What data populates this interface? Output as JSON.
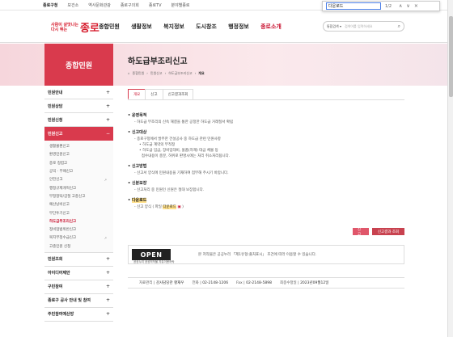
{
  "topbar": {
    "links": [
      "종로구청",
      "보건소",
      "역사문화관광",
      "종로구의회",
      "종로TV",
      "분야별종로"
    ]
  },
  "findbar": {
    "query": "다운로드",
    "count": "1/2",
    "up": "∧",
    "down": "∨",
    "close": "×"
  },
  "logo": {
    "line1": "사람이 살맛나는",
    "line2": "다시 뛰는",
    "name": "종로"
  },
  "gnb": [
    "종합민원",
    "생활정보",
    "복지정보",
    "도시창조",
    "행정정보",
    "종로소개"
  ],
  "gsearch": {
    "select": "통합검색 ▾",
    "placeholder": "검색어를 입력하세요"
  },
  "lnb": {
    "title": "종합민원",
    "items_top": [
      {
        "label": "민원안내",
        "pm": "+"
      },
      {
        "label": "민원상담",
        "pm": "+"
      },
      {
        "label": "민원신청",
        "pm": "+"
      }
    ],
    "active": {
      "label": "민원신고",
      "pm": "−"
    },
    "sub": [
      {
        "label": "생활불편신고",
        "ext": ""
      },
      {
        "label": "환경민원신고",
        "ext": ""
      },
      {
        "label": "종로 청렴고",
        "ext": ""
      },
      {
        "label": "공익 · 부패신고",
        "ext": ""
      },
      {
        "label": "안전신고",
        "ext": "↗"
      },
      {
        "label": "행정규제개혁신고",
        "ext": ""
      },
      {
        "label": "부정청탁/갑질 고충신고",
        "ext": ""
      },
      {
        "label": "예산낭비신고",
        "ext": ""
      },
      {
        "label": "무단투기신고",
        "ext": ""
      },
      {
        "label": "하도급부조리신고",
        "ext": ""
      },
      {
        "label": "정비업법위반신고",
        "ext": ""
      },
      {
        "label": "복지부정수급신고",
        "ext": "↗"
      },
      {
        "label": "고충민원 신청",
        "ext": ""
      }
    ],
    "items_bottom": [
      {
        "label": "민원조회",
        "pm": "+"
      },
      {
        "label": "아이디어제안",
        "pm": "+"
      },
      {
        "label": "구민참여",
        "pm": "+"
      },
      {
        "label": "종로구 공사 안내 및 참여",
        "pm": "+"
      },
      {
        "label": "주민참여예산방",
        "pm": "+"
      }
    ]
  },
  "page": {
    "title": "하도급부조리신고",
    "breadcrumb": [
      "⌂",
      "종합민원",
      "민원신고",
      "하도급부조리신고",
      "개요"
    ]
  },
  "tabs": [
    "개요",
    "신고",
    "신고결과조회"
  ],
  "sections": [
    {
      "heading": "운영목적",
      "lines": [
        "하도급 부조리의 신속 해결을 통한 공정한 하도급 거래질서 확립"
      ]
    },
    {
      "heading": "신고대상",
      "lines": [
        "종로구청에서 발주한 건설공사 중 하도급 관련 민원사항",
        "하도급 계약의 부적정",
        "하도급 임금, 장비임대비, 물품(자재) 대금 체불 등",
        "접수내용이 충분, 허위로 판명시에는 처리 취소처리됩니다."
      ]
    },
    {
      "heading": "신고방법",
      "lines": [
        "신고서 양식에 민원내용을 기재하여 첨부해 주시기 바랍니다."
      ]
    },
    {
      "heading": "신분보장",
      "lines": [
        "신고처리 중 민원인 신원은 절대 보장합니다."
      ]
    }
  ],
  "download": {
    "heading": "다운로드",
    "prefix": "신고 양식 ( 파일 ",
    "link": "다운로드",
    "suffix": " )"
  },
  "buttons": {
    "report": "신고",
    "result": "신고결과 조회"
  },
  "licence": {
    "badge": "OPEN",
    "sub": "공공누리 공공저작물 자유이용허락",
    "text": "본 저작물은 공공누리 「제1유형:출처표시」 조건에 따라 이용할 수 있습니다."
  },
  "footer": {
    "dept_label": "자료관리",
    "dept": "감사담당관 황재우",
    "tel_label": "전화",
    "tel": "02-2148-1206",
    "fax_label": "Fax",
    "fax": "02-2148-5898",
    "date_label": "최종수정일",
    "date": "2023년09월12일"
  }
}
